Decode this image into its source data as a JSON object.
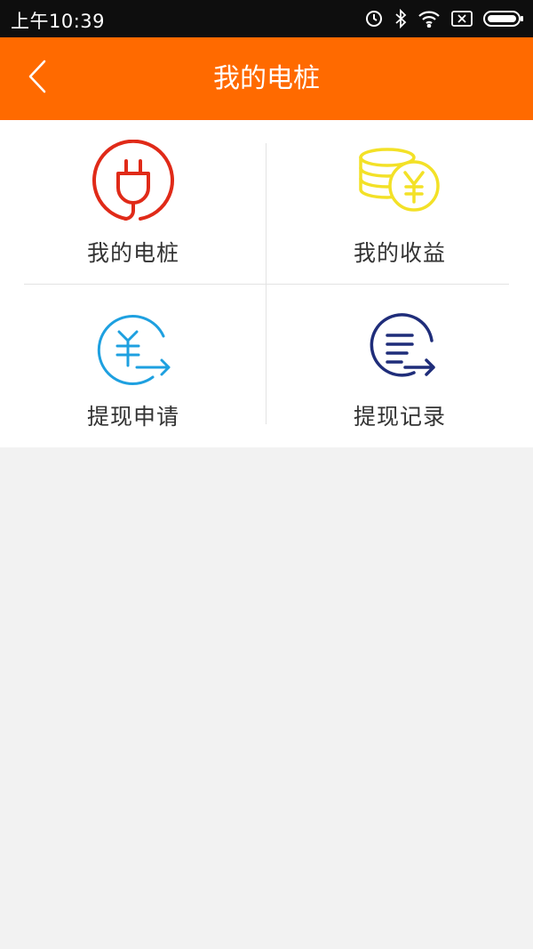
{
  "status_bar": {
    "time": "上午10:39",
    "icons": [
      "alarm-icon",
      "bluetooth-icon",
      "wifi-icon",
      "sim-off-icon",
      "battery-icon"
    ]
  },
  "header": {
    "title": "我的电桩",
    "back_icon": "chevron-left-icon",
    "background": "#ff6a00"
  },
  "menu": {
    "items": [
      {
        "label": "我的电桩",
        "icon": "plug-icon",
        "color": "#e02a18"
      },
      {
        "label": "我的收益",
        "icon": "coins-icon",
        "color": "#f3e127"
      },
      {
        "label": "提现申请",
        "icon": "withdraw-apply-icon",
        "color": "#1ea0e0"
      },
      {
        "label": "提现记录",
        "icon": "withdraw-record-icon",
        "color": "#1f2d7a"
      }
    ]
  }
}
